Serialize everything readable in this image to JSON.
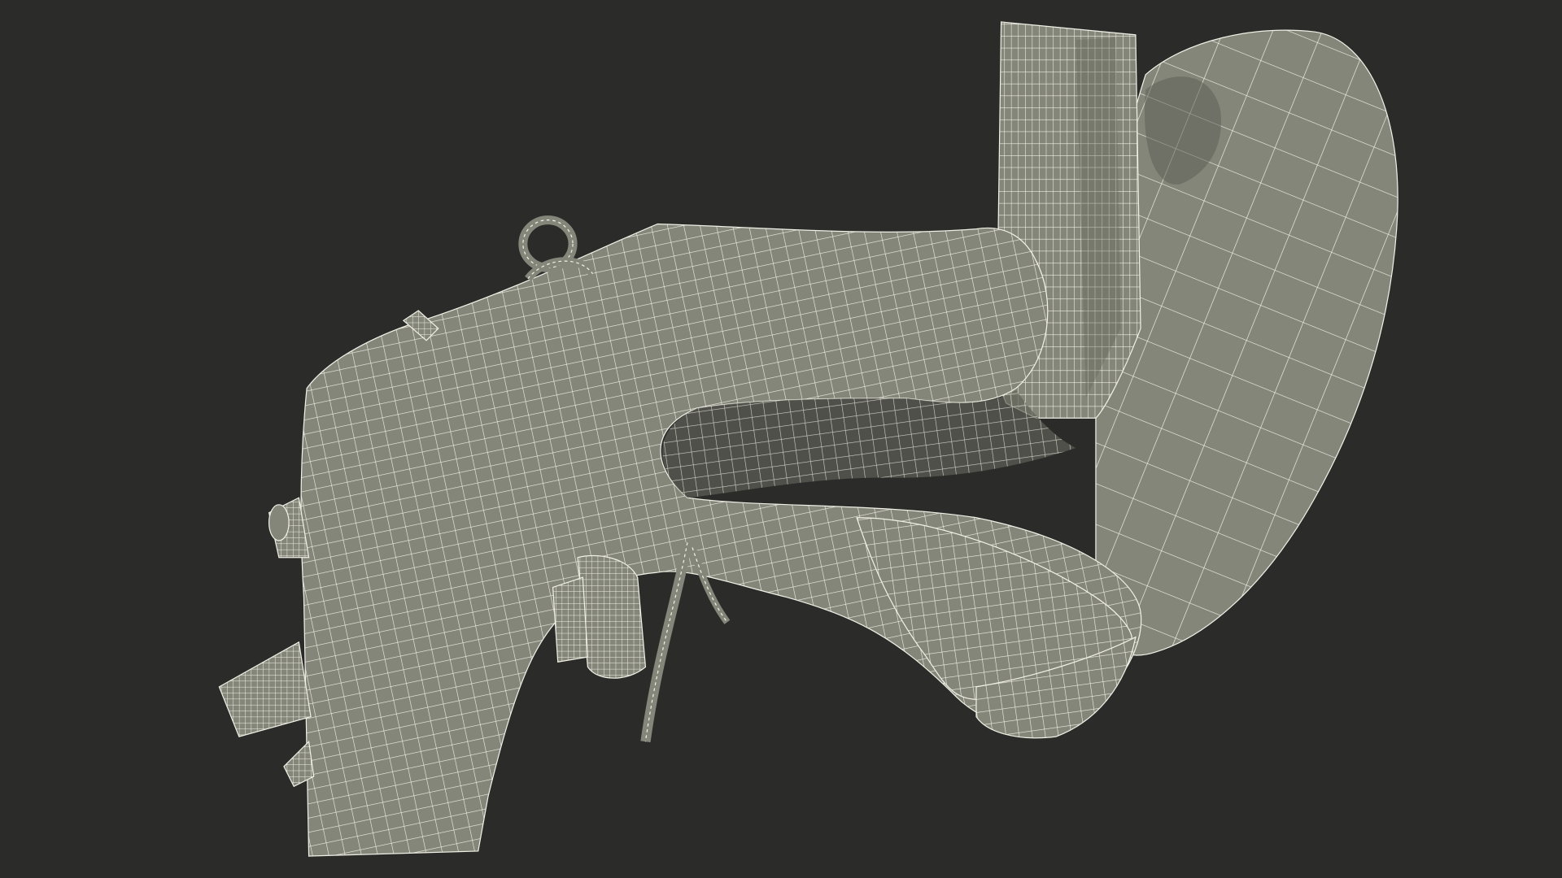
{
  "scene": {
    "background_color": "#2b2b2a",
    "surface_color": "#84867a",
    "surface_shade_color": "#5f6157",
    "wire_color": "#f1f0e6",
    "subject": "wireframe-ear-model"
  }
}
